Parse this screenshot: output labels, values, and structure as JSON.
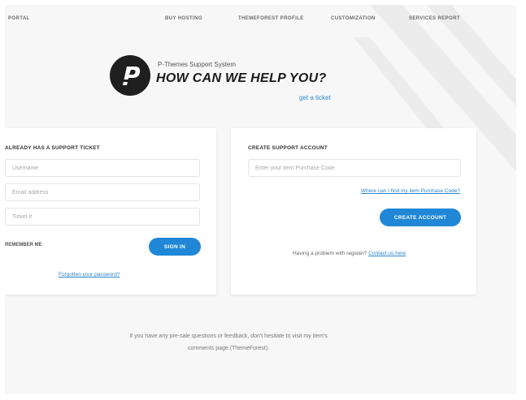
{
  "nav": {
    "items": [
      "PORTAL",
      "BUY HOSTING",
      "THEMEFOREST PROFILE",
      "CUSTOMIZATION",
      "SERVICES REPORT"
    ]
  },
  "hero": {
    "subtitle": "P-Themes Support System",
    "title": "HOW CAN WE HELP YOU?",
    "ticket_link": "get a ticket"
  },
  "login": {
    "title": "ALREADY HAS A SUPPORT TICKET",
    "username_placeholder": "Username",
    "email_placeholder": "Email address",
    "password_placeholder": "Ticket #",
    "remember_label": "REMEMBER ME",
    "signin_label": "SIGN IN",
    "forgot_link": "Forgotten your password?"
  },
  "create": {
    "title": "CREATE SUPPORT ACCOUNT",
    "code_placeholder": "Enter your item Purchase Code",
    "where_link": "Where can I find my item Purchase Code?",
    "create_label": "CREATE ACCOUNT",
    "problem_text": "Having a problem with register?",
    "contact_link": "Contact us here"
  },
  "footer": {
    "line1": "If you have any pre-sale questions or feedback, don't hesitate to visit my item's",
    "line2": "comments page (ThemeForest)."
  },
  "colors": {
    "accent": "#1f87d5",
    "link": "#2a84cc",
    "logo_bg": "#1f1f1f"
  }
}
